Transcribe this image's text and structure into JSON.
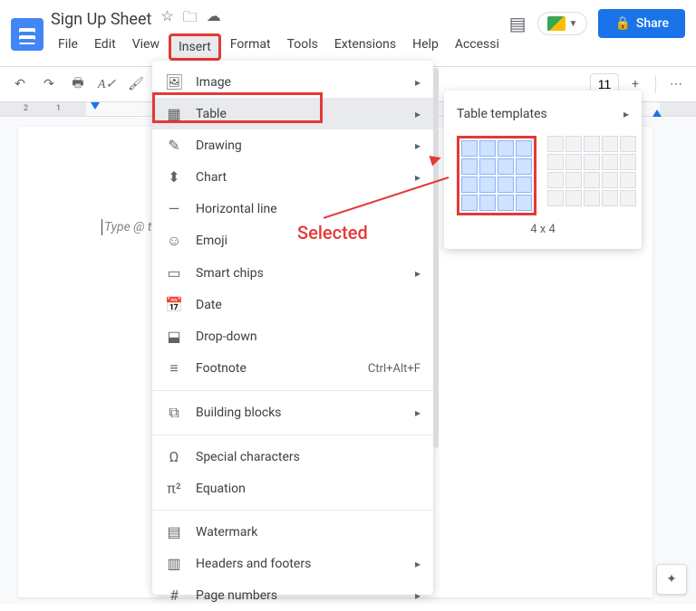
{
  "doc": {
    "title": "Sign Up Sheet"
  },
  "menubar": [
    "File",
    "Edit",
    "View",
    "Insert",
    "Format",
    "Tools",
    "Extensions",
    "Help",
    "Accessi"
  ],
  "active_menu_index": 3,
  "share": {
    "label": "Share"
  },
  "toolbar": {
    "font_size": "11"
  },
  "ruler": {
    "marks": [
      "2",
      "1"
    ]
  },
  "placeholder": "Type @ t",
  "insert_menu": [
    {
      "icon": "image",
      "label": "Image",
      "arrow": true
    },
    {
      "icon": "table",
      "label": "Table",
      "arrow": true,
      "highlighted": true
    },
    {
      "icon": "drawing",
      "label": "Drawing",
      "arrow": true
    },
    {
      "icon": "chart",
      "label": "Chart",
      "arrow": true
    },
    {
      "icon": "hr",
      "label": "Horizontal line"
    },
    {
      "icon": "emoji",
      "label": "Emoji"
    },
    {
      "icon": "chips",
      "label": "Smart chips",
      "arrow": true
    },
    {
      "icon": "date",
      "label": "Date"
    },
    {
      "icon": "dropdown",
      "label": "Drop-down"
    },
    {
      "icon": "footnote",
      "label": "Footnote",
      "shortcut": "Ctrl+Alt+F"
    },
    {
      "sep": true
    },
    {
      "icon": "blocks",
      "label": "Building blocks",
      "arrow": true
    },
    {
      "sep": true
    },
    {
      "icon": "omega",
      "label": "Special characters"
    },
    {
      "icon": "pi",
      "label": "Equation"
    },
    {
      "sep": true
    },
    {
      "icon": "watermark",
      "label": "Watermark"
    },
    {
      "icon": "hf",
      "label": "Headers and footers",
      "arrow": true
    },
    {
      "icon": "pagenum",
      "label": "Page numbers",
      "arrow": true
    }
  ],
  "submenu": {
    "header": "Table templates",
    "size_label": "4 x 4",
    "selected_label": "Selected"
  },
  "icons": {
    "image": "🖼",
    "table": "▦",
    "drawing": "✎",
    "chart": "⬍",
    "hr": "—",
    "emoji": "☺",
    "chips": "▭",
    "date": "📅",
    "dropdown": "⬓",
    "footnote": "≡",
    "blocks": "⧉",
    "omega": "Ω",
    "pi": "π²",
    "watermark": "▤",
    "hf": "▥",
    "pagenum": "#"
  }
}
